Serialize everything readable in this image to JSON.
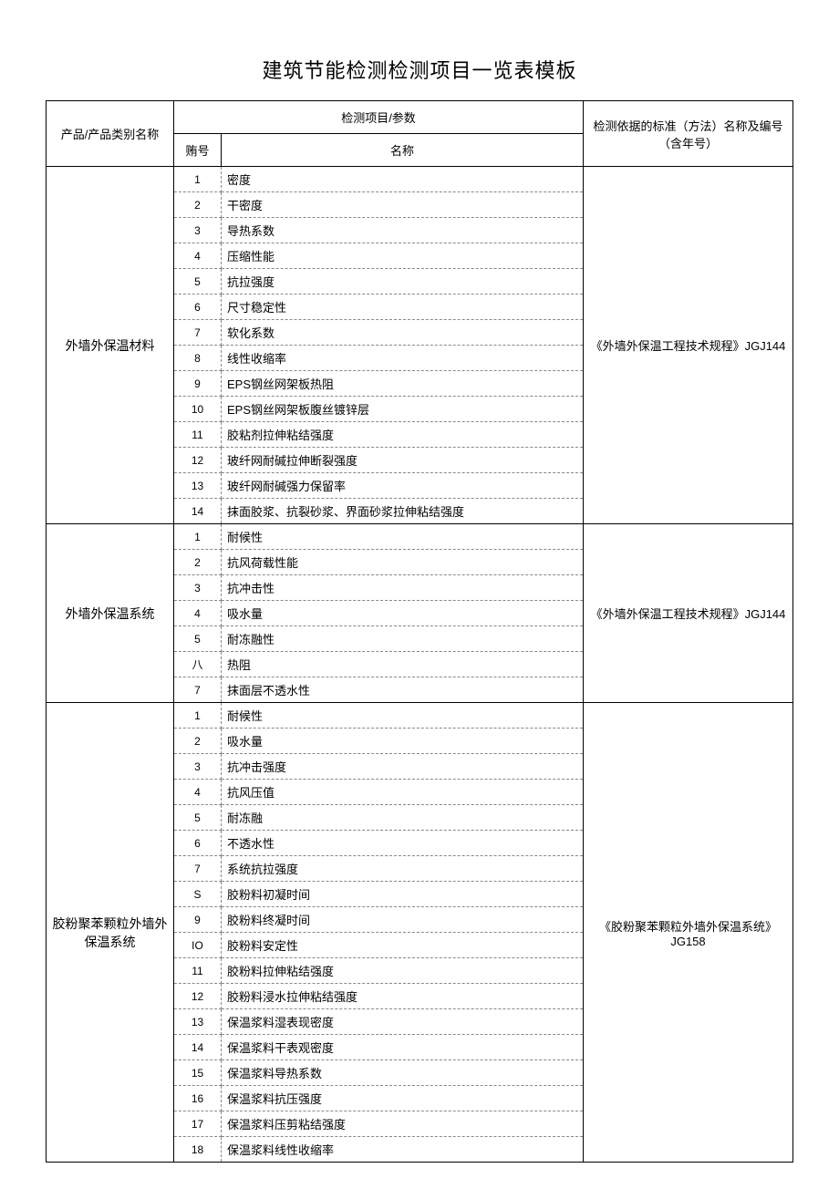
{
  "title": "建筑节能检测检测项目一览表模板",
  "headers": {
    "product": "产品/产品类别名称",
    "param_group": "检测项目/参数",
    "seq": "贿号",
    "name": "名称",
    "standard": "检测依据的标准（方法）名称及编号（含年号）"
  },
  "groups": [
    {
      "product": "外墙外保温材料",
      "standard": "《外墙外保温工程技术规程》JGJ144",
      "rows": [
        {
          "seq": "1",
          "name": "密度"
        },
        {
          "seq": "2",
          "name": "干密度"
        },
        {
          "seq": "3",
          "name": "导热系数"
        },
        {
          "seq": "4",
          "name": "压缩性能"
        },
        {
          "seq": "5",
          "name": "抗拉强度"
        },
        {
          "seq": "6",
          "name": "尺寸稳定性"
        },
        {
          "seq": "7",
          "name": "软化系数"
        },
        {
          "seq": "8",
          "name": "线性收缩率"
        },
        {
          "seq": "9",
          "name": "EPS钢丝网架板热阻"
        },
        {
          "seq": "10",
          "name": "EPS钢丝网架板腹丝镀锌层"
        },
        {
          "seq": "11",
          "name": "胶粘剂拉伸粘结强度"
        },
        {
          "seq": "12",
          "name": "玻纤网耐碱拉伸断裂强度"
        },
        {
          "seq": "13",
          "name": "玻纤网耐碱强力保留率"
        },
        {
          "seq": "14",
          "name": "抹面胶浆、抗裂砂浆、界面砂浆拉伸粘结强度"
        }
      ]
    },
    {
      "product": "外墙外保温系统",
      "standard": "《外墙外保温工程技术规程》JGJ144",
      "rows": [
        {
          "seq": "1",
          "name": "耐候性"
        },
        {
          "seq": "2",
          "name": "抗风荷载性能"
        },
        {
          "seq": "3",
          "name": "抗冲击性"
        },
        {
          "seq": "4",
          "name": "吸水量"
        },
        {
          "seq": "5",
          "name": "耐冻融性"
        },
        {
          "seq": "八",
          "name": "热阻"
        },
        {
          "seq": "7",
          "name": "抹面层不透水性"
        }
      ]
    },
    {
      "product": "胶粉聚苯颗粒外墙外保温系统",
      "standard": "《胶粉聚苯颗粒外墙外保温系统》JG158",
      "rows": [
        {
          "seq": "1",
          "name": "耐候性"
        },
        {
          "seq": "2",
          "name": "吸水量"
        },
        {
          "seq": "3",
          "name": "抗冲击强度"
        },
        {
          "seq": "4",
          "name": "抗风压值"
        },
        {
          "seq": "5",
          "name": "耐冻融"
        },
        {
          "seq": "6",
          "name": "不透水性"
        },
        {
          "seq": "7",
          "name": "系统抗拉强度"
        },
        {
          "seq": "S",
          "name": "胶粉料初凝时间"
        },
        {
          "seq": "9",
          "name": "胶粉料终凝时间"
        },
        {
          "seq": "IO",
          "name": "胶粉料安定性"
        },
        {
          "seq": "11",
          "name": "胶粉料拉伸粘结强度"
        },
        {
          "seq": "12",
          "name": "胶粉料浸水拉伸粘结强度"
        },
        {
          "seq": "13",
          "name": "保温浆料湿表现密度"
        },
        {
          "seq": "14",
          "name": "保温浆料干表观密度"
        },
        {
          "seq": "15",
          "name": "保温浆料导热系数"
        },
        {
          "seq": "16",
          "name": "保温浆料抗压强度"
        },
        {
          "seq": "17",
          "name": "保温浆料压剪粘结强度"
        },
        {
          "seq": "18",
          "name": "保温浆料线性收缩率"
        }
      ]
    }
  ]
}
